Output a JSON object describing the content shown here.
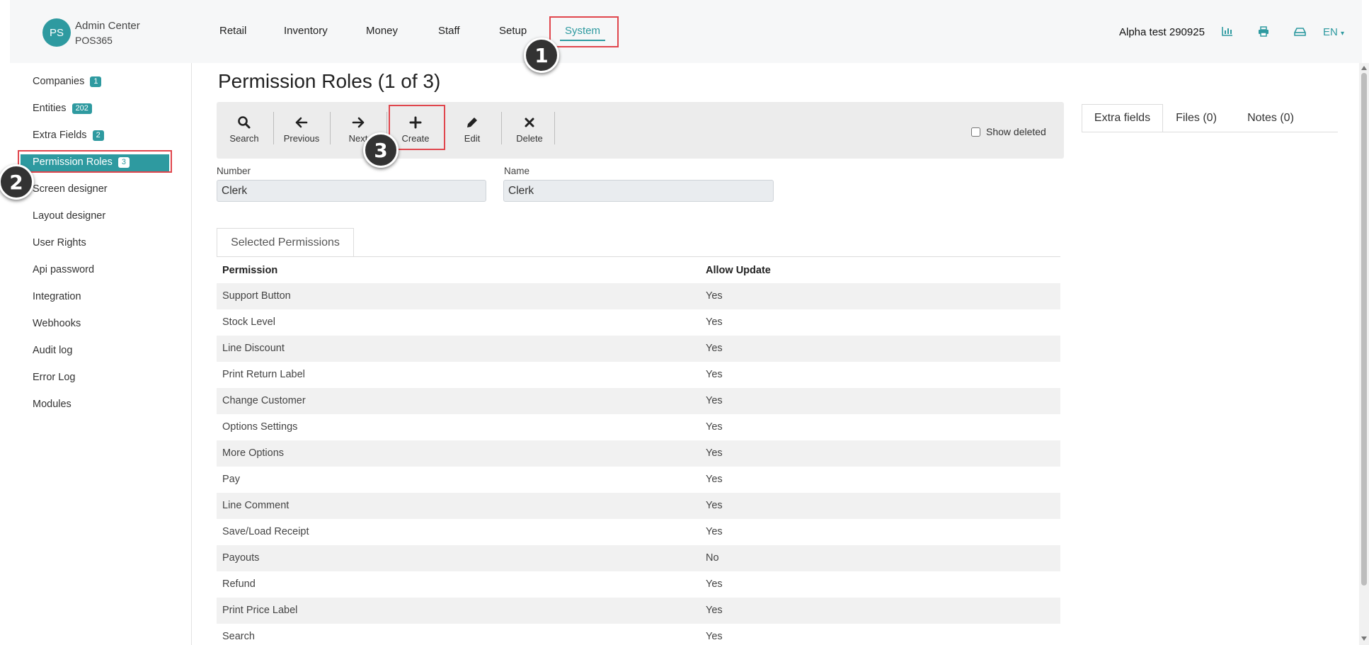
{
  "brand": {
    "logo": "PS",
    "title": "Admin Center",
    "subtitle": "POS365"
  },
  "topnav": [
    "Retail",
    "Inventory",
    "Money",
    "Staff",
    "Setup",
    "System"
  ],
  "header": {
    "company": "Alpha test 290925",
    "icons": [
      "chart-icon",
      "printer-icon",
      "cash-drawer-icon"
    ],
    "language": "EN"
  },
  "sidebar": [
    {
      "label": "Companies",
      "badge": "1"
    },
    {
      "label": "Entities",
      "badge": "202"
    },
    {
      "label": "Extra Fields",
      "badge": "2"
    },
    {
      "label": "Permission Roles",
      "badge": "3"
    },
    {
      "label": "Screen designer"
    },
    {
      "label": "Layout designer"
    },
    {
      "label": "User Rights"
    },
    {
      "label": "Api password"
    },
    {
      "label": "Integration"
    },
    {
      "label": "Webhooks"
    },
    {
      "label": "Audit log"
    },
    {
      "label": "Error Log"
    },
    {
      "label": "Modules"
    }
  ],
  "page": {
    "title": "Permission Roles (1 of 3)"
  },
  "toolbar": {
    "search": "Search",
    "previous": "Previous",
    "next": "Next",
    "create": "Create",
    "edit": "Edit",
    "delete": "Delete",
    "show_deleted": "Show deleted"
  },
  "form": {
    "number_label": "Number",
    "number_value": "Clerk",
    "name_label": "Name",
    "name_value": "Clerk"
  },
  "permissions": {
    "tab": "Selected Permissions",
    "headers": [
      "Permission",
      "Allow Update"
    ],
    "rows": [
      [
        "Support Button",
        "Yes"
      ],
      [
        "Stock Level",
        "Yes"
      ],
      [
        "Line Discount",
        "Yes"
      ],
      [
        "Print Return Label",
        "Yes"
      ],
      [
        "Change Customer",
        "Yes"
      ],
      [
        "Options Settings",
        "Yes"
      ],
      [
        "More Options",
        "Yes"
      ],
      [
        "Pay",
        "Yes"
      ],
      [
        "Line Comment",
        "Yes"
      ],
      [
        "Save/Load Receipt",
        "Yes"
      ],
      [
        "Payouts",
        "No"
      ],
      [
        "Refund",
        "Yes"
      ],
      [
        "Print Price Label",
        "Yes"
      ],
      [
        "Search",
        "Yes"
      ]
    ]
  },
  "right_tabs": [
    "Extra fields",
    "Files (0)",
    "Notes (0)"
  ],
  "callouts": [
    "1",
    "2",
    "3"
  ],
  "colors": {
    "accent": "#2e9aa0",
    "highlight": "#e0464d"
  }
}
